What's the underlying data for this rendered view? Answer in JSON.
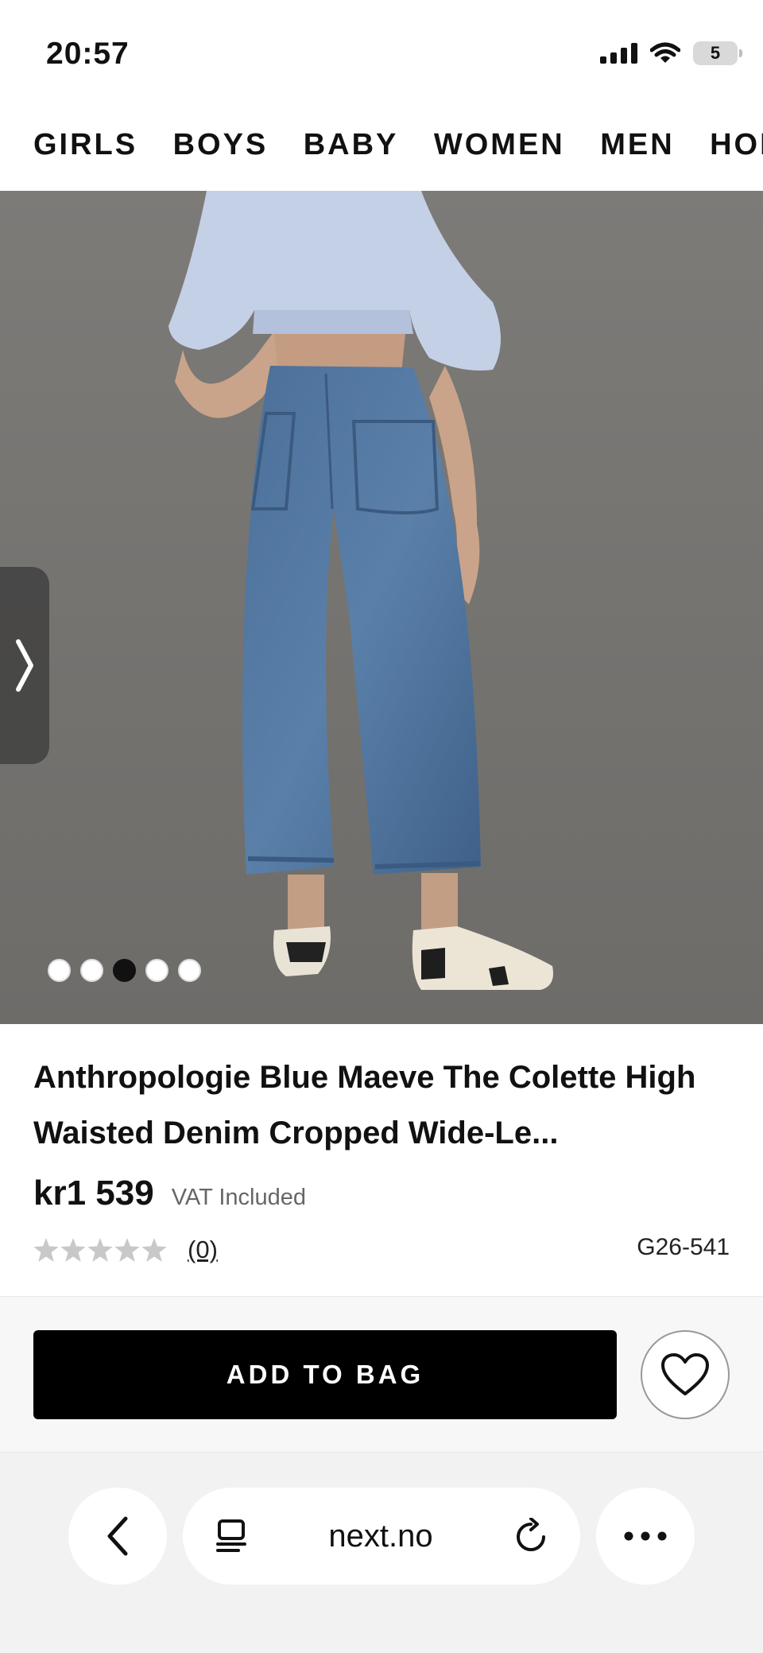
{
  "status_bar": {
    "time": "20:57",
    "battery": "5"
  },
  "category_nav": [
    "GIRLS",
    "BOYS",
    "BABY",
    "WOMEN",
    "MEN",
    "HOLIDAY"
  ],
  "gallery": {
    "dot_count": 5,
    "active_dot": 3
  },
  "product": {
    "title": "Anthropologie Blue Maeve The Colette High Waisted Denim Cropped Wide-Le...",
    "price": "kr1 539",
    "vat": "VAT Included",
    "rating": 0,
    "review_count": "(0)",
    "code": "G26-541"
  },
  "actions": {
    "add_to_bag": "ADD TO BAG"
  },
  "browser": {
    "url": "next.no"
  },
  "icons": {
    "next": "chevron-right-icon",
    "wishlist": "heart-icon",
    "back": "chevron-left-icon",
    "tabs": "reader-icon",
    "reload": "reload-icon",
    "more": "ellipsis-icon"
  },
  "colors": {
    "accent": "#000000",
    "star_empty": "#c8c8c8",
    "image_background": "#777673"
  }
}
